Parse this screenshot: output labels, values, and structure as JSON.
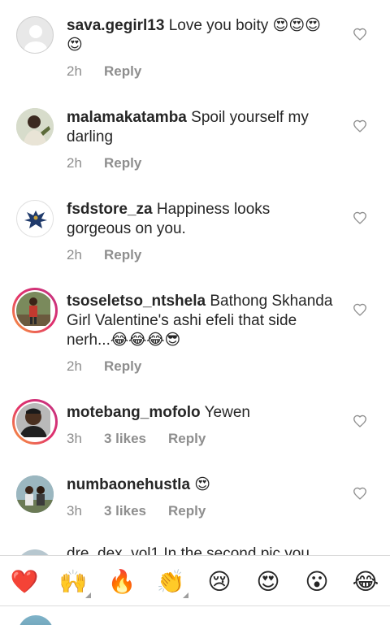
{
  "comments": [
    {
      "username": "sava.gegirl13",
      "text": " Love you boity 😍😍😍😍",
      "time": "2h",
      "likes": "",
      "reply_label": "Reply"
    },
    {
      "username": "malamakatamba",
      "text": " Spoil yourself my darling",
      "time": "2h",
      "likes": "",
      "reply_label": "Reply"
    },
    {
      "username": "fsdstore_za",
      "text": " Happiness looks gorgeous on you.",
      "time": "2h",
      "likes": "",
      "reply_label": "Reply"
    },
    {
      "username": "tsoseletso_ntshela",
      "text": " Bathong Skhanda Girl Valentine's ashi efeli that side nerh...😂😂😂😎",
      "time": "2h",
      "likes": "",
      "reply_label": "Reply"
    },
    {
      "username": "motebang_mofolo",
      "text": " Yewen",
      "time": "3h",
      "likes": "3 likes",
      "reply_label": "Reply"
    },
    {
      "username": "numbaonehustla",
      "text": " 😍",
      "time": "3h",
      "likes": "3 likes",
      "reply_label": "Reply"
    }
  ],
  "partial_comment": "dre_dex_vol1 In the second pic you",
  "emoji_bar": [
    {
      "glyph": "❤️",
      "name": "red-heart"
    },
    {
      "glyph": "🙌",
      "name": "raising-hands",
      "has_variants": true
    },
    {
      "glyph": "🔥",
      "name": "fire"
    },
    {
      "glyph": "👏",
      "name": "clapping-hands",
      "has_variants": true
    },
    {
      "glyph": "😢",
      "name": "crying-face"
    },
    {
      "glyph": "😍",
      "name": "heart-eyes"
    },
    {
      "glyph": "😮",
      "name": "surprised-face"
    },
    {
      "glyph": "😂",
      "name": "tears-of-joy"
    }
  ],
  "colors": {
    "text": "#262626",
    "muted": "#8e8e8e",
    "divider": "#dbdbdb",
    "story_ring_start": "#f9a13a",
    "story_ring_end": "#c13584"
  }
}
